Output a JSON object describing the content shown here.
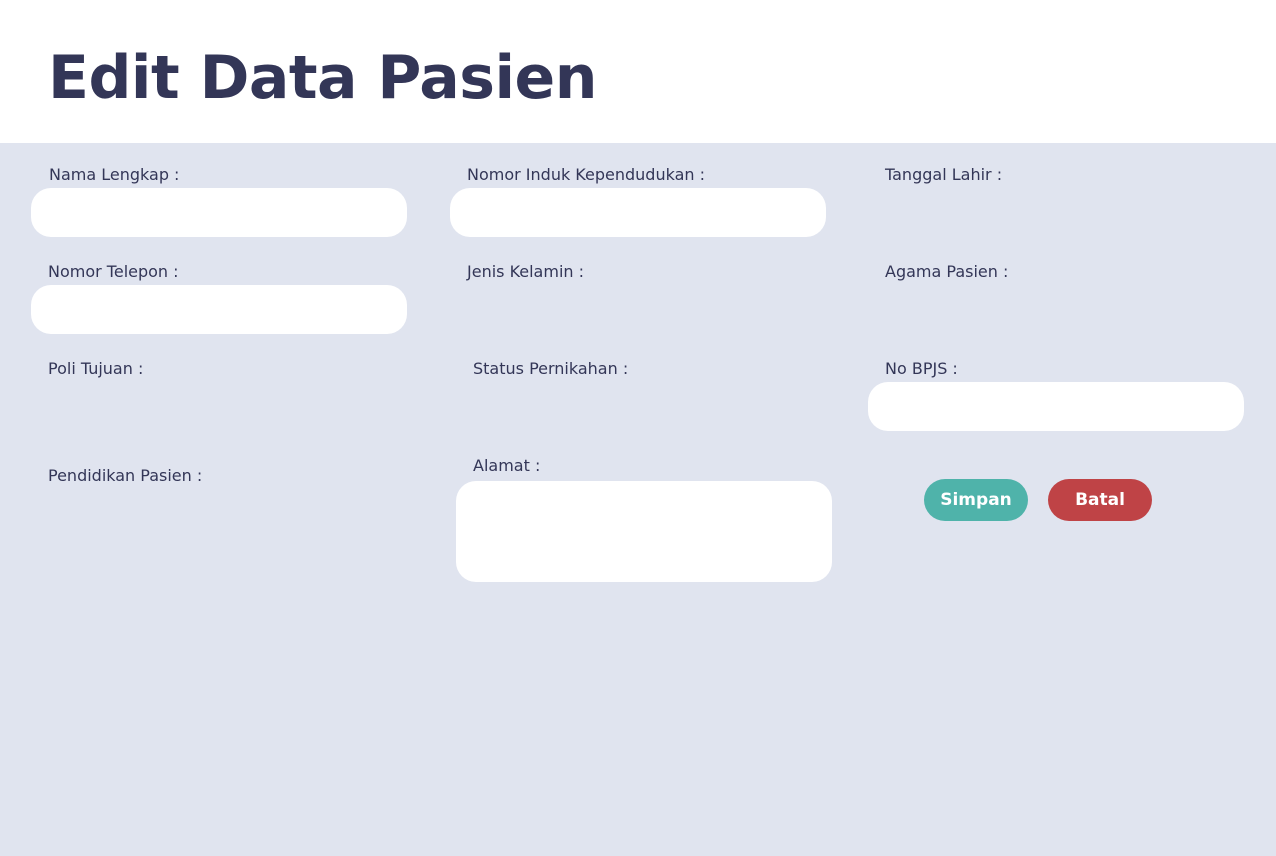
{
  "page": {
    "title": "Edit Data Pasien"
  },
  "form": {
    "nama_lengkap": {
      "label": "Nama Lengkap :",
      "value": ""
    },
    "nik": {
      "label": "Nomor Induk Kependudukan :",
      "value": ""
    },
    "tanggal_lahir": {
      "label": "Tanggal Lahir :"
    },
    "nomor_telepon": {
      "label": "Nomor Telepon :",
      "value": ""
    },
    "jenis_kelamin": {
      "label": "Jenis Kelamin :"
    },
    "agama_pasien": {
      "label": "Agama Pasien :"
    },
    "poli_tujuan": {
      "label": "Poli Tujuan :"
    },
    "status_pernikahan": {
      "label": "Status Pernikahan :"
    },
    "no_bpjs": {
      "label": "No BPJS :",
      "value": ""
    },
    "pendidikan_pasien": {
      "label": "Pendidikan Pasien :"
    },
    "alamat": {
      "label": "Alamat :",
      "value": ""
    }
  },
  "actions": {
    "save_label": "Simpan",
    "cancel_label": "Batal"
  },
  "colors": {
    "text": "#333657",
    "form_background": "#e0e4ef",
    "field_background": "#ffffff",
    "save_button": "#4fb3aa",
    "cancel_button": "#bf4346"
  }
}
